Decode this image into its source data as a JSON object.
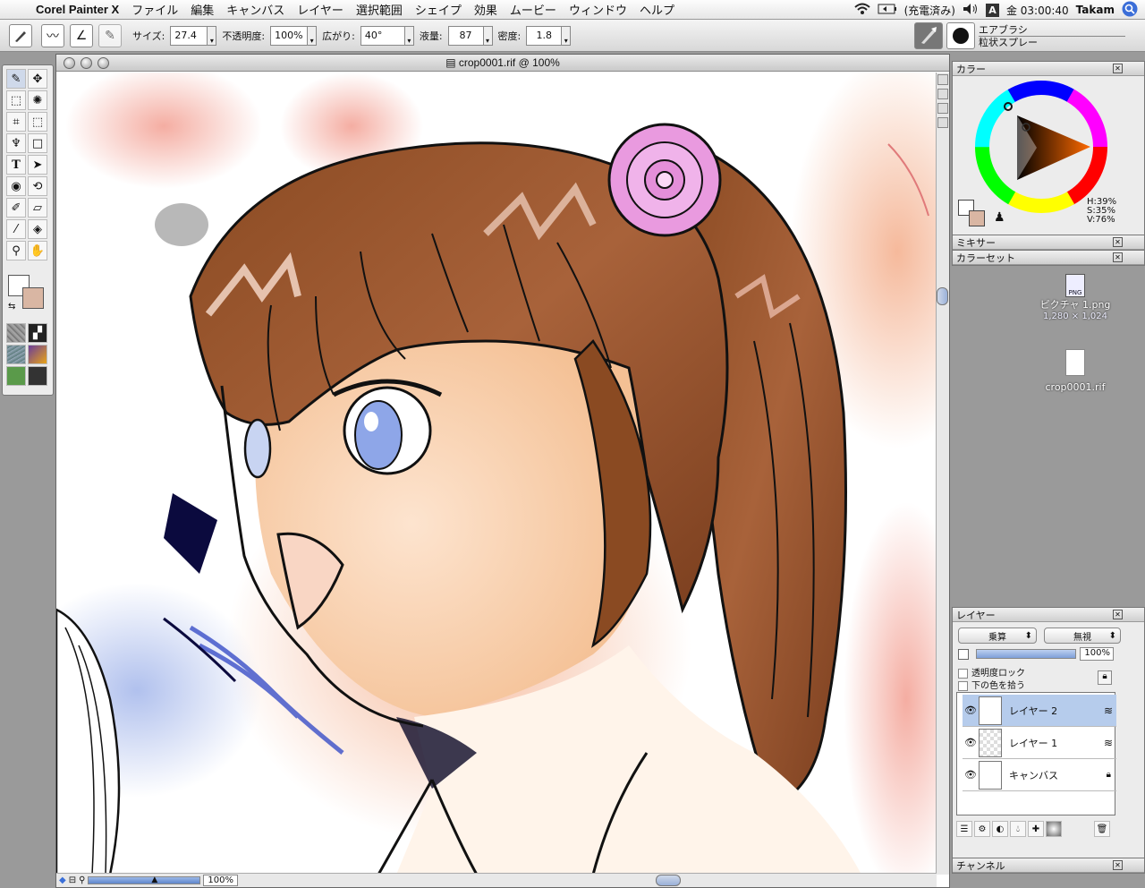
{
  "menubar": {
    "app_name": "Corel Painter X",
    "items": [
      "ファイル",
      "編集",
      "キャンバス",
      "レイヤー",
      "選択範囲",
      "シェイプ",
      "効果",
      "ムービー",
      "ウィンドウ",
      "ヘルプ"
    ],
    "battery": "(充電済み)",
    "clock": "金 03:00:40",
    "user": "Takam"
  },
  "propbar": {
    "size_label": "サイズ:",
    "size_value": "27.4",
    "opacity_label": "不透明度:",
    "opacity_value": "100%",
    "spread_label": "広がり:",
    "spread_value": "40°",
    "flow_label": "液量:",
    "flow_value": "87",
    "density_label": "密度:",
    "density_value": "1.8",
    "brush_category": "エアブラシ",
    "brush_variant": "粒状スプレー"
  },
  "document": {
    "title": "crop0001.rif @ 100%",
    "zoom": "100%"
  },
  "color_panel": {
    "title": "カラー",
    "h": "H:39%",
    "s": "S:35%",
    "v": "V:76%",
    "main_color": "#d9b6a3"
  },
  "mixer_panel": {
    "title": "ミキサー"
  },
  "colorset_panel": {
    "title": "カラーセット"
  },
  "desktop": {
    "file1_name": "ピクチャ 1.png",
    "file1_size": "1,280 × 1,024",
    "file2_name": "crop0001.rif",
    "png_badge": "PNG"
  },
  "layers_panel": {
    "title": "レイヤー",
    "composite_method": "乗算",
    "composite_depth": "無視",
    "opacity": "100%",
    "lock_transparency": "透明度ロック",
    "pick_underlying": "下の色を拾う",
    "layers": [
      {
        "name": "レイヤー 2",
        "selected": true
      },
      {
        "name": "レイヤー 1",
        "selected": false
      },
      {
        "name": "キャンバス",
        "selected": false
      }
    ]
  },
  "channels_panel": {
    "title": "チャンネル"
  }
}
